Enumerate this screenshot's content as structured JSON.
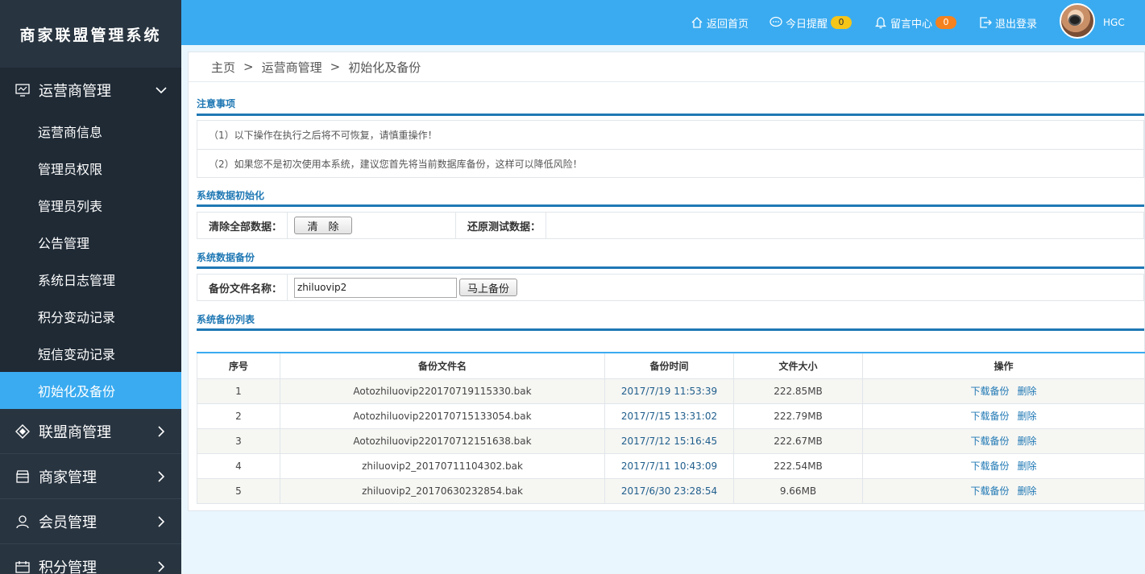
{
  "brand": "商家联盟管理系统",
  "sidebar": {
    "groups": [
      {
        "label": "运营商管理",
        "icon": "monitor-icon",
        "open": true
      },
      {
        "label": "联盟商管理",
        "icon": "diamond-icon"
      },
      {
        "label": "商家管理",
        "icon": "store-icon"
      },
      {
        "label": "会员管理",
        "icon": "user-icon"
      },
      {
        "label": "积分管理",
        "icon": "calendar-icon"
      }
    ],
    "sub_items": [
      "运营商信息",
      "管理员权限",
      "管理员列表",
      "公告管理",
      "系统日志管理",
      "积分变动记录",
      "短信变动记录",
      "初始化及备份"
    ]
  },
  "topbar": {
    "home": "返回首页",
    "reminder": "今日提醒",
    "reminder_count": "0",
    "messages": "留言中心",
    "messages_count": "0",
    "logout": "退出登录",
    "username": "HGC"
  },
  "breadcrumb": [
    "主页",
    "运营商管理",
    "初始化及备份"
  ],
  "breadcrumb_sep": ">",
  "notice": {
    "title": "注意事项",
    "lines": [
      "（1）以下操作在执行之后将不可恢复，请慎重操作！",
      "（2）如果您不是初次使用本系统，建议您首先将当前数据库备份，这样可以降低风险！"
    ]
  },
  "init": {
    "title": "系统数据初始化",
    "clear_label": "清除全部数据：",
    "clear_button": "清　除",
    "restore_label": "还原测试数据："
  },
  "backup": {
    "title": "系统数据备份",
    "name_label": "备份文件名称：",
    "name_value": "zhiluovip2",
    "button": "马上备份"
  },
  "list": {
    "title": "系统备份列表",
    "headers": [
      "序号",
      "备份文件名",
      "备份时间",
      "文件大小",
      "操作"
    ],
    "download": "下载备份",
    "delete": "删除",
    "rows": [
      {
        "no": "1",
        "file": "Aotozhiluovip220170719115330.bak",
        "time": "2017/7/19 11:53:39",
        "size": "222.85MB"
      },
      {
        "no": "2",
        "file": "Aotozhiluovip220170715133054.bak",
        "time": "2017/7/15 13:31:02",
        "size": "222.79MB"
      },
      {
        "no": "3",
        "file": "Aotozhiluovip220170712151638.bak",
        "time": "2017/7/12 15:16:45",
        "size": "222.67MB"
      },
      {
        "no": "4",
        "file": "zhiluovip2_20170711104302.bak",
        "time": "2017/7/11 10:43:09",
        "size": "222.54MB"
      },
      {
        "no": "5",
        "file": "zhiluovip2_20170630232854.bak",
        "time": "2017/6/30 23:28:54",
        "size": "9.66MB"
      }
    ]
  },
  "colors": {
    "accent": "#3aabf0",
    "sidebar": "#283440",
    "section": "#1f78b4"
  }
}
